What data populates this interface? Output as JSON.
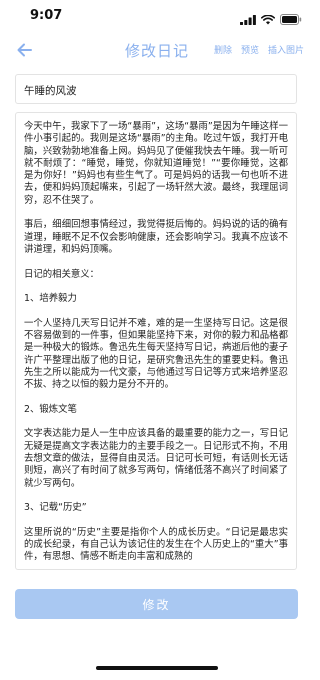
{
  "status": {
    "time": "9:07",
    "icons": [
      "signal-icon",
      "wifi-icon",
      "battery-icon"
    ]
  },
  "nav": {
    "title": "修改日记",
    "back_icon": "back-arrow-icon",
    "actions": [
      "删除",
      "预览",
      "插入图片"
    ]
  },
  "editor": {
    "title_value": "午睡的风波",
    "content_paragraphs": [
      "今天中午，我家下了一场“暴雨”，这场“暴雨”是因为午睡这样一件小事引起的。我则是这场“暴雨”的主角。吃过午饭，我打开电脑，兴致勃勃地准备上网。妈妈见了便催我快去午睡。我一听可就不耐烦了：“睡觉，睡觉，你就知道睡觉！”“要你睡觉，这都是为你好！”妈妈也有些生气了。可是妈妈的话我一句也听不进去，便和妈妈顶起嘴来，引起了一场轩然大波。最终，我理屈词穷，忍不住哭了。",
      "事后，细细回想事情经过，我觉得挺后悔的。妈妈说的话的确有道理，睡眠不足不仅会影响健康，还会影响学习。我真不应该不讲道理，和妈妈顶嘴。",
      "日记的相关意义：",
      "1、培养毅力",
      "一个人坚持几天写日记并不难，难的是一生坚持写日记。这是很不容易做到的一件事，但如果能坚持下来，对你的毅力和品格都是一种极大的锻炼。鲁迅先生每天坚持写日记，病逝后他的妻子许广平整理出版了他的日记，是研究鲁迅先生的重要史料。鲁迅先生之所以能成为一代文豪，与他通过写日记等方式来培养坚忍不拔、持之以恒的毅力是分不开的。",
      "2、锻炼文笔",
      "文字表达能力是人一生中应该具备的最重要的能力之一，写日记无疑是提高文字表达能力的主要手段之一。日记形式不拘，不用去想文章的做法，显得自由灵活。日记可长可短，有话则长无话则短，高兴了有时间了就多写两句，情绪低落不高兴了时间紧了就少写两句。",
      "3、记载“历史”",
      "这里所说的“历史”主要是指你个人的成长历史。“日记是最忠实的成长纪录，有自己认为该记住的发生在个人历史上的“重大”事件，有思想、情感不断走向丰富和成熟的"
    ]
  },
  "footer": {
    "submit_label": "修改"
  },
  "colors": {
    "accent": "#8ab0ee",
    "button_bg": "#a9c8f2",
    "border": "#e3e3e3"
  }
}
